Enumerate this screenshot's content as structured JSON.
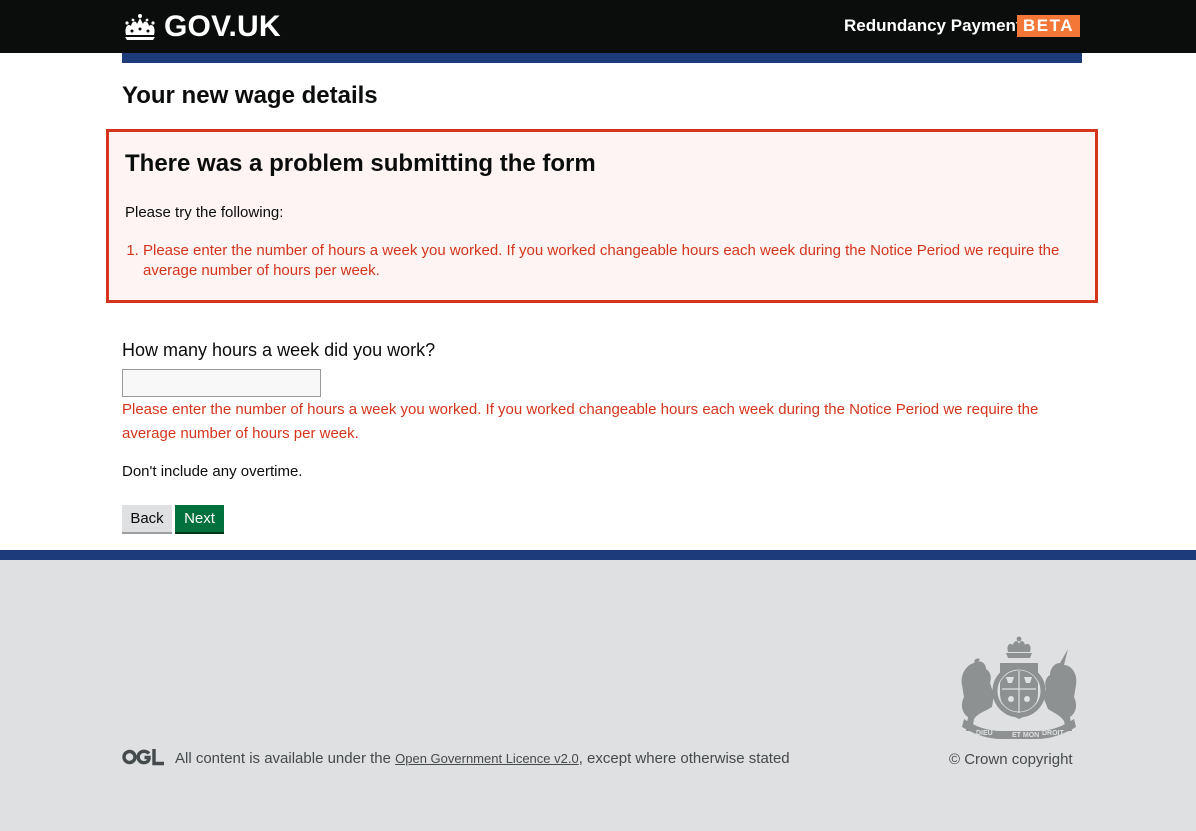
{
  "header": {
    "logo_text": "GOV.UK",
    "service_name": "Redundancy Payments",
    "phase_tag": "BETA",
    "colors": {
      "background": "#0b0c0c",
      "phase": "#f47738",
      "bar": "#1d3b7a"
    }
  },
  "main": {
    "title": "Your new wage details",
    "error_summary": {
      "heading": "There was a problem submitting the form",
      "intro": "Please try the following:",
      "errors": [
        "Please enter the number of hours a week you worked. If you worked changeable hours each week during the Notice Period we require the average number of hours per week."
      ],
      "border_color": "#d4351c"
    },
    "field": {
      "label": "How many hours a week did you work?",
      "value": "",
      "error": "Please enter the number of hours a week you worked. If you worked changeable hours each week during the Notice Period we require the average number of hours per week.",
      "hint": "Don't include any overtime."
    },
    "buttons": {
      "back": "Back",
      "next": "Next"
    }
  },
  "footer": {
    "licence_prefix": "All content is available under the ",
    "licence_link": "Open Government Licence v2.0",
    "licence_suffix": ", except where otherwise stated",
    "copyright": "© Crown copyright",
    "crest_text": {
      "top": "QUI MAL Y PENSE",
      "left": "DIEU",
      "right": "DROIT",
      "bottom": "ET MON"
    }
  },
  "icons": [
    "crown-icon",
    "ogl-icon",
    "royal-crest"
  ]
}
